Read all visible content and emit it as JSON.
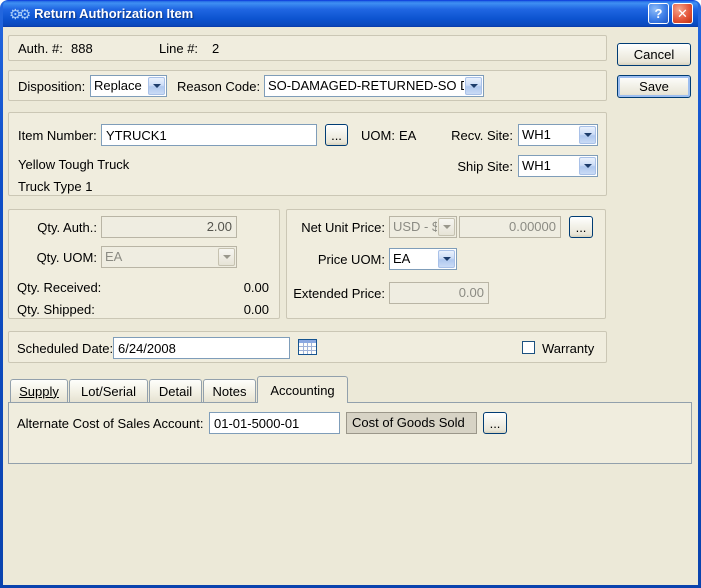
{
  "window": {
    "title": "Return Authorization Item",
    "icon_glyph": "⚙⚙",
    "help_glyph": "?",
    "close_glyph": "✕"
  },
  "colors": {
    "titlebar_blue": "#0C53D0",
    "dialog_bg": "#ECE9D8",
    "close_red": "#D6492C",
    "input_border": "#7F9DB9"
  },
  "header": {
    "auth_label": "Auth. #:",
    "auth_value": "888",
    "line_label": "Line #:",
    "line_value": "2"
  },
  "actions": {
    "cancel_label": "Cancel",
    "save_label": "Save"
  },
  "disposition_row": {
    "disposition_label": "Disposition:",
    "disposition_value": "Replace",
    "reason_label": "Reason Code:",
    "reason_value": "SO-DAMAGED-RETURNED-SO D"
  },
  "item_section": {
    "item_number_label": "Item Number:",
    "item_number_value": "YTRUCK1",
    "browse_label": "...",
    "uom_label": "UOM:",
    "uom_value": "EA",
    "recv_site_label": "Recv. Site:",
    "recv_site_value": "WH1",
    "ship_site_label": "Ship Site:",
    "ship_site_value": "WH1",
    "description_line1": "Yellow Tough Truck",
    "description_line2": "Truck Type 1"
  },
  "qty_section": {
    "qty_auth_label": "Qty. Auth.:",
    "qty_auth_value": "2.00",
    "qty_uom_label": "Qty. UOM:",
    "qty_uom_value": "EA",
    "qty_received_label": "Qty. Received:",
    "qty_received_value": "0.00",
    "qty_shipped_label": "Qty. Shipped:",
    "qty_shipped_value": "0.00"
  },
  "price_section": {
    "net_unit_price_label": "Net Unit Price:",
    "currency_value": "USD - $",
    "net_unit_price_value": "0.00000",
    "browse_label": "...",
    "price_uom_label": "Price UOM:",
    "price_uom_value": "EA",
    "extended_price_label": "Extended Price:",
    "extended_price_value": "0.00"
  },
  "schedule_section": {
    "scheduled_date_label": "Scheduled Date:",
    "scheduled_date_value": "6/24/2008",
    "warranty_label": "Warranty",
    "warranty_checked": false
  },
  "tabs": [
    {
      "label": "Supply",
      "active": false
    },
    {
      "label": "Lot/Serial",
      "active": false
    },
    {
      "label": "Detail",
      "active": false
    },
    {
      "label": "Notes",
      "active": false
    },
    {
      "label": "Accounting",
      "active": true
    }
  ],
  "accounting_tab": {
    "account_label": "Alternate Cost of Sales Account:",
    "account_value": "01-01-5000-01",
    "account_description": "Cost of Goods Sold",
    "browse_label": "..."
  }
}
